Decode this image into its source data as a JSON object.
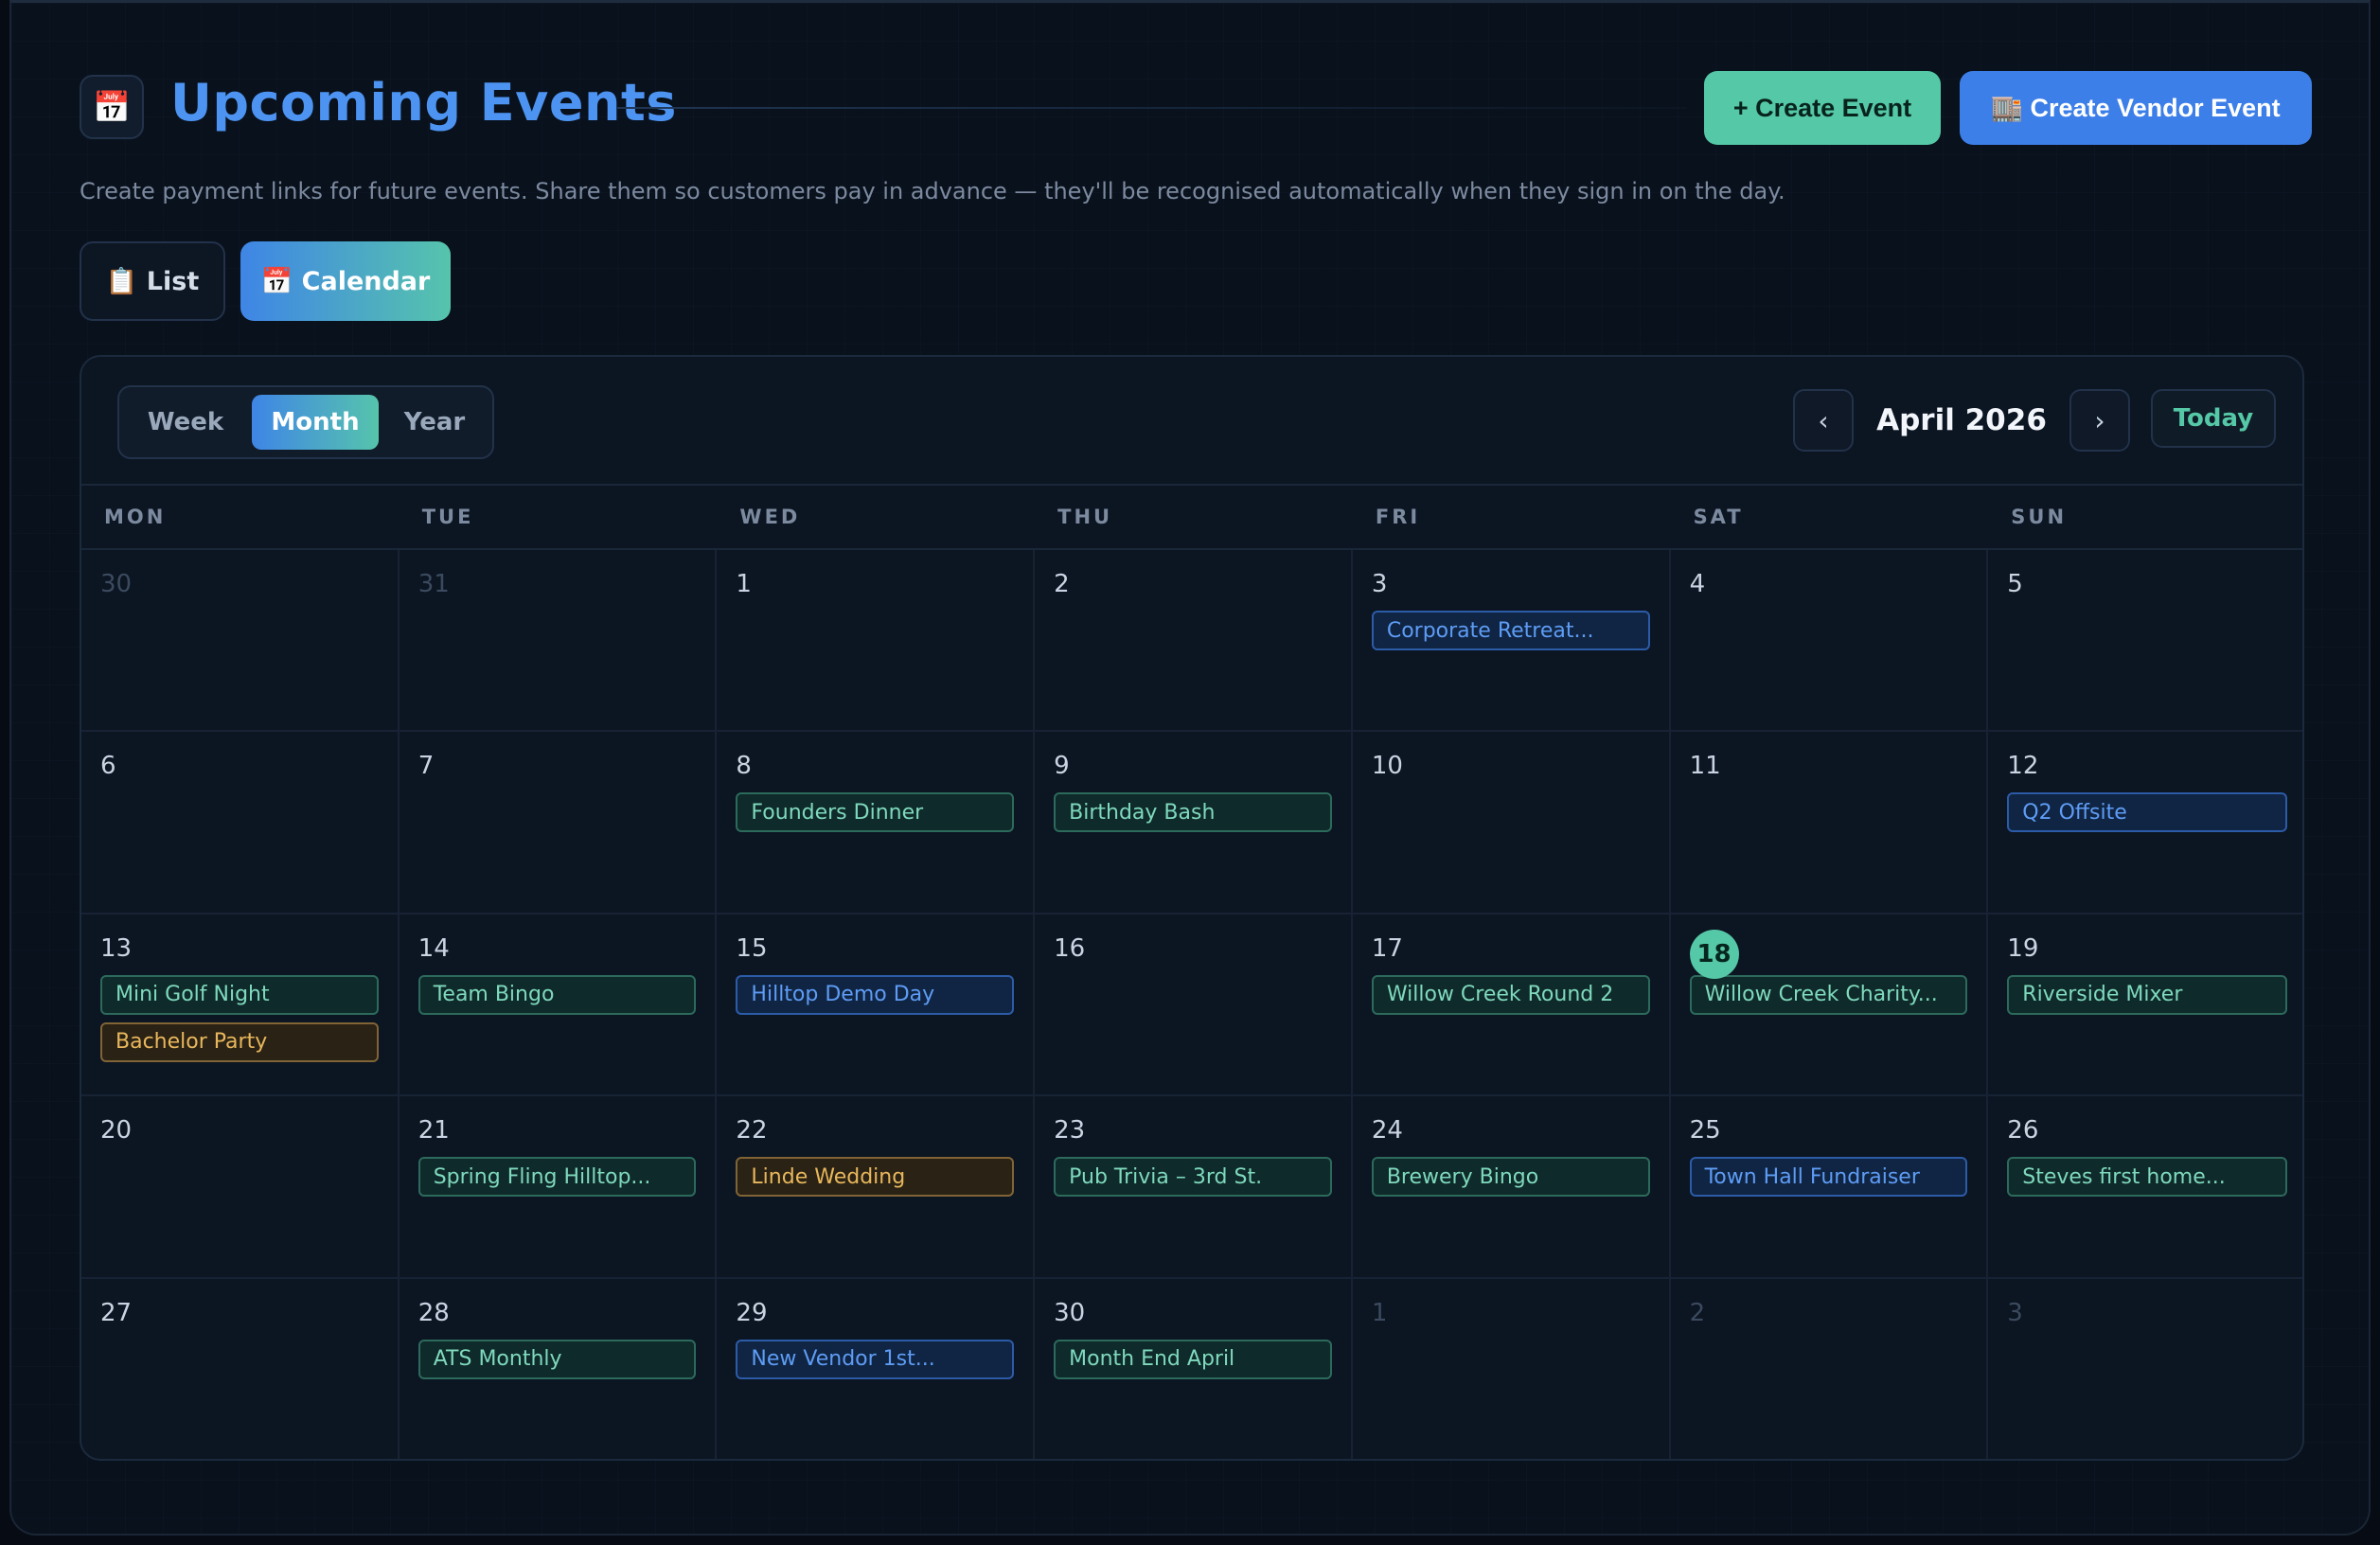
{
  "header": {
    "icon": "calendar-icon",
    "icon_glyph": "📅",
    "title": "Upcoming Events",
    "create_event_label": "+ Create Event",
    "create_vendor_event_label": "🏬 Create Vendor Event",
    "subtitle": "Create payment links for future events. Share them so customers pay in advance — they'll be recognised automatically when they sign in on the day."
  },
  "view_toggle": {
    "list_label": "📋 List",
    "calendar_label": "📅 Calendar",
    "active": "Calendar"
  },
  "calendar": {
    "range_options": [
      "Week",
      "Month",
      "Year"
    ],
    "active_range": "Month",
    "prev_label": "‹",
    "next_label": "›",
    "month_label": "April 2026",
    "today_label": "Today",
    "weekdays": [
      "MON",
      "TUE",
      "WED",
      "THU",
      "FRI",
      "SAT",
      "SUN"
    ],
    "colors": {
      "green": "#7ed9bd",
      "blue": "#5e9cf5",
      "amber": "#e8b75c",
      "today": "#55c8a7"
    },
    "days": [
      {
        "num": "30",
        "muted": true,
        "events": []
      },
      {
        "num": "31",
        "muted": true,
        "events": []
      },
      {
        "num": "1",
        "events": []
      },
      {
        "num": "2",
        "events": []
      },
      {
        "num": "3",
        "events": [
          {
            "title": "Corporate Retreat...",
            "color": "blue"
          }
        ]
      },
      {
        "num": "4",
        "events": []
      },
      {
        "num": "5",
        "events": []
      },
      {
        "num": "6",
        "events": []
      },
      {
        "num": "7",
        "events": []
      },
      {
        "num": "8",
        "events": [
          {
            "title": "Founders Dinner",
            "color": "green"
          }
        ]
      },
      {
        "num": "9",
        "events": [
          {
            "title": "Birthday Bash",
            "color": "green"
          }
        ]
      },
      {
        "num": "10",
        "events": []
      },
      {
        "num": "11",
        "events": []
      },
      {
        "num": "12",
        "events": [
          {
            "title": "Q2 Offsite",
            "color": "blue"
          }
        ]
      },
      {
        "num": "13",
        "events": [
          {
            "title": "Mini Golf Night",
            "color": "green"
          },
          {
            "title": "Bachelor Party",
            "color": "amber"
          }
        ]
      },
      {
        "num": "14",
        "events": [
          {
            "title": "Team Bingo",
            "color": "green"
          }
        ]
      },
      {
        "num": "15",
        "events": [
          {
            "title": "Hilltop Demo Day",
            "color": "blue"
          }
        ]
      },
      {
        "num": "16",
        "events": []
      },
      {
        "num": "17",
        "events": [
          {
            "title": "Willow Creek Round 2",
            "color": "green"
          }
        ]
      },
      {
        "num": "18",
        "today": true,
        "events": [
          {
            "title": "Willow Creek Charity...",
            "color": "green"
          }
        ]
      },
      {
        "num": "19",
        "events": [
          {
            "title": "Riverside Mixer",
            "color": "green"
          }
        ]
      },
      {
        "num": "20",
        "events": []
      },
      {
        "num": "21",
        "events": [
          {
            "title": "Spring Fling Hilltop...",
            "color": "green"
          }
        ]
      },
      {
        "num": "22",
        "events": [
          {
            "title": "Linde Wedding",
            "color": "amber"
          }
        ]
      },
      {
        "num": "23",
        "events": [
          {
            "title": "Pub Trivia – 3rd St.",
            "color": "green"
          }
        ]
      },
      {
        "num": "24",
        "events": [
          {
            "title": "Brewery Bingo",
            "color": "green"
          }
        ]
      },
      {
        "num": "25",
        "events": [
          {
            "title": "Town Hall Fundraiser",
            "color": "blue"
          }
        ]
      },
      {
        "num": "26",
        "events": [
          {
            "title": "Steves first home...",
            "color": "green"
          }
        ]
      },
      {
        "num": "27",
        "events": []
      },
      {
        "num": "28",
        "events": [
          {
            "title": "ATS Monthly",
            "color": "green"
          }
        ]
      },
      {
        "num": "29",
        "events": [
          {
            "title": "New Vendor 1st...",
            "color": "blue"
          }
        ]
      },
      {
        "num": "30",
        "events": [
          {
            "title": "Month End April",
            "color": "green"
          }
        ]
      },
      {
        "num": "1",
        "muted": true,
        "events": []
      },
      {
        "num": "2",
        "muted": true,
        "events": []
      },
      {
        "num": "3",
        "muted": true,
        "events": []
      }
    ]
  }
}
